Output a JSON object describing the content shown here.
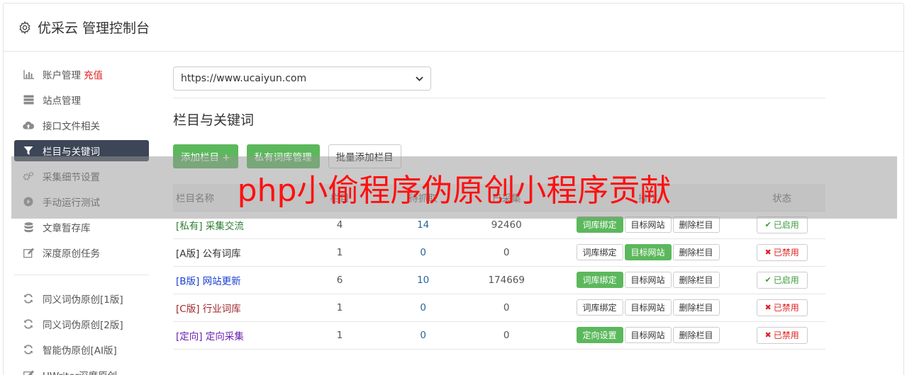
{
  "header": {
    "title": "优采云 管理控制台"
  },
  "sidebar": {
    "items": [
      {
        "label": "账户管理",
        "extra": "充值",
        "icon": "bar-chart-icon"
      },
      {
        "label": "站点管理",
        "icon": "server-icon"
      },
      {
        "label": "接口文件相关",
        "icon": "cloud-upload-icon"
      },
      {
        "label": "栏目与关键词",
        "icon": "filter-icon",
        "active": true
      },
      {
        "label": "采集细节设置",
        "icon": "cogs-icon"
      },
      {
        "label": "手动运行测试",
        "icon": "play-icon"
      },
      {
        "label": "文章暂存库",
        "icon": "database-icon"
      },
      {
        "label": "深度原创任务",
        "icon": "edit-icon"
      }
    ],
    "items2": [
      {
        "label": "同义词伪原创[1版]",
        "icon": "refresh-icon"
      },
      {
        "label": "同义词伪原创[2版]",
        "icon": "refresh-icon"
      },
      {
        "label": "智能伪原创[AI版]",
        "icon": "refresh-icon"
      },
      {
        "label": "UWriter深度原创",
        "icon": "edit-icon"
      }
    ]
  },
  "main": {
    "site_select": {
      "value": "https://www.ucaiyun.com"
    },
    "section_title": "栏目与关键词",
    "toolbar": {
      "add_label": "添加栏目 +",
      "private_label": "私有词库管理",
      "batch_label": "批量添加栏目"
    },
    "table": {
      "headers": [
        "栏目名称",
        "栏目",
        "待抓取",
        "已采集",
        "操作",
        "状态"
      ],
      "rows": [
        {
          "tag": "[私有]",
          "name": "采集交流",
          "color": "#2e7d32",
          "c1": "4",
          "c2": "14",
          "c3": "92460",
          "b1": "词库绑定",
          "b1_green": true,
          "b2": "目标网站",
          "b2_green": false,
          "b3": "删除栏目",
          "status": "已启用",
          "on": true
        },
        {
          "tag": "[A版]",
          "name": "公有词库",
          "color": "#333333",
          "c1": "1",
          "c2": "0",
          "c3": "0",
          "b1": "词库绑定",
          "b1_green": false,
          "b2": "目标网站",
          "b2_green": true,
          "b3": "删除栏目",
          "status": "已禁用",
          "on": false
        },
        {
          "tag": "[B版]",
          "name": "网站更新",
          "color": "#1a3fd0",
          "c1": "6",
          "c2": "10",
          "c3": "174669",
          "b1": "词库绑定",
          "b1_green": true,
          "b2": "目标网站",
          "b2_green": false,
          "b3": "删除栏目",
          "status": "已启用",
          "on": true
        },
        {
          "tag": "[C版]",
          "name": "行业词库",
          "color": "#a0272b",
          "c1": "1",
          "c2": "0",
          "c3": "0",
          "b1": "词库绑定",
          "b1_green": false,
          "b2": "目标网站",
          "b2_green": false,
          "b3": "删除栏目",
          "status": "已禁用",
          "on": false
        },
        {
          "tag": "[定向]",
          "name": "定向采集",
          "color": "#6a1fb0",
          "c1": "1",
          "c2": "0",
          "c3": "0",
          "b1": "定向设置",
          "b1_green": true,
          "b2": "目标网站",
          "b2_green": false,
          "b3": "删除栏目",
          "status": "已禁用",
          "on": false
        }
      ]
    }
  },
  "overlay": {
    "text": "php小偷程序伪原创小程序贡献"
  }
}
